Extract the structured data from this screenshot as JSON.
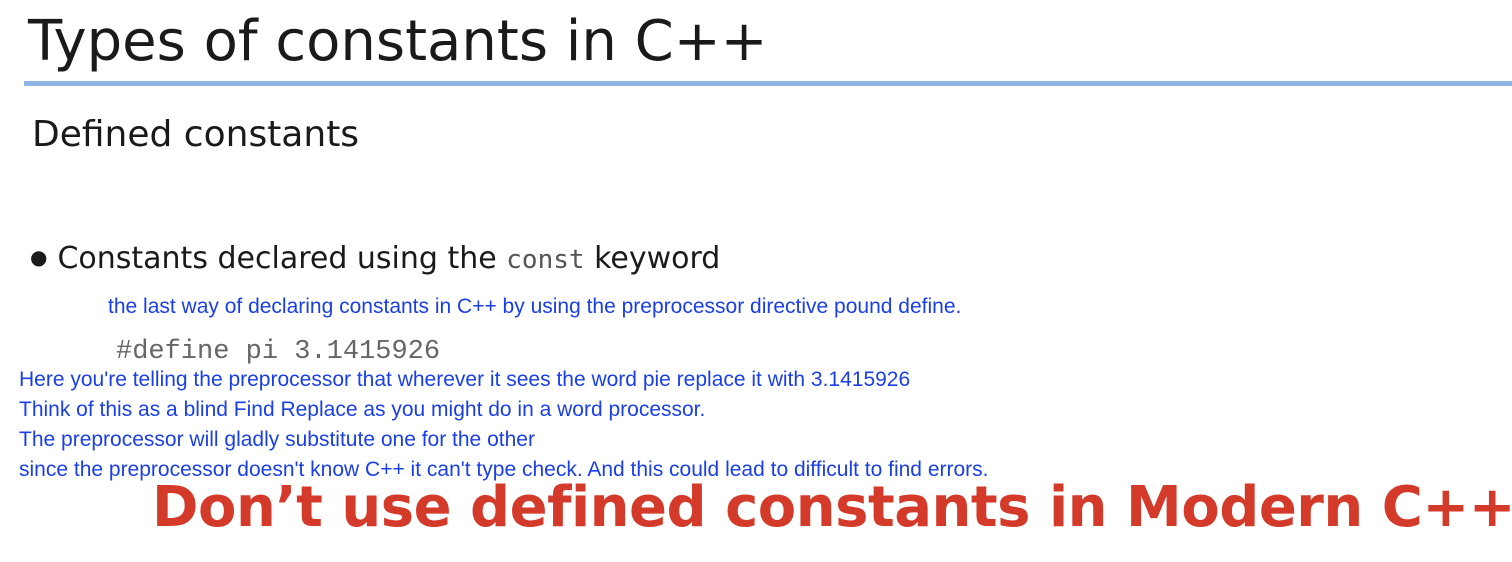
{
  "slide": {
    "title": "Types of constants in C++",
    "subtitle": "Defined constants",
    "bullet": {
      "prefix": "Constants declared using the",
      "keyword": "const",
      "suffix": "keyword"
    },
    "code": "#define pi 3.1415926",
    "warning": "Don’t use defined constants in Modern C++"
  },
  "annotations": {
    "intro": "the last way of declaring constants in C++ by using the preprocessor directive pound define.",
    "lines": [
      "Here you're telling the preprocessor that wherever it sees the word pie replace it with 3.1415926",
      "Think of this as a blind Find Replace as you might do in a word processor.",
      "The preprocessor will gladly substitute one for the other",
      "since the preprocessor doesn't know C++ it can't type check. And this could lead to difficult to find errors."
    ]
  },
  "colors": {
    "title_rule": "#8fb4e6",
    "annotation_text": "#1a3fe8",
    "warning_text": "#d43a2a"
  }
}
